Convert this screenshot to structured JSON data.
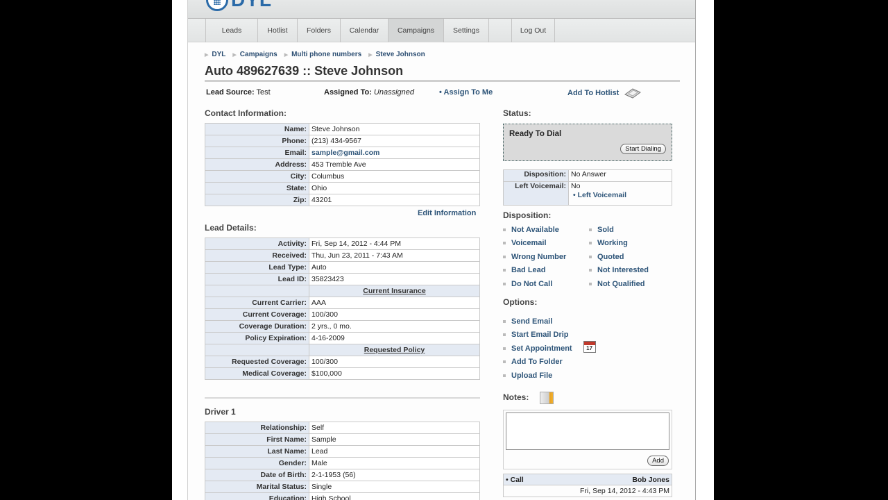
{
  "app": {
    "logo_text": "DYL"
  },
  "nav": {
    "items": [
      {
        "label": "Leads"
      },
      {
        "label": "Hotlist"
      },
      {
        "label": "Folders"
      },
      {
        "label": "Calendar"
      },
      {
        "label": "Campaigns",
        "active": true
      },
      {
        "label": "Settings"
      },
      {
        "label": ""
      },
      {
        "label": "Log Out"
      }
    ]
  },
  "breadcrumb": [
    "DYL",
    "Campaigns",
    "Multi phone numbers",
    "Steve Johnson"
  ],
  "page_title": "Auto 489627639 :: Steve Johnson",
  "meta": {
    "lead_source_label": "Lead Source:",
    "lead_source_value": "Test",
    "assigned_to_label": "Assigned To:",
    "assigned_to_value": "Unassigned",
    "assign_to_me": "• Assign To Me",
    "add_to_hotlist": "Add To Hotlist"
  },
  "contact": {
    "title": "Contact Information:",
    "rows": [
      {
        "k": "Name:",
        "v": "Steve Johnson"
      },
      {
        "k": "Phone:",
        "v": "(213) 434-9567"
      },
      {
        "k": "Email:",
        "v": "sample@gmail.com"
      },
      {
        "k": "Address:",
        "v": "453 Tremble Ave"
      },
      {
        "k": "City:",
        "v": "Columbus"
      },
      {
        "k": "State:",
        "v": "Ohio"
      },
      {
        "k": "Zip:",
        "v": "43201"
      }
    ],
    "edit_link": "Edit Information"
  },
  "lead_details": {
    "title": "Lead Details:",
    "rows": [
      {
        "k": "Activity:",
        "v": "Fri, Sep 14, 2012 - 4:44 PM"
      },
      {
        "k": "Received:",
        "v": "Thu, Jun 23, 2011 - 7:43 AM"
      },
      {
        "k": "Lead Type:",
        "v": "Auto"
      },
      {
        "k": "Lead ID:",
        "v": "35823423"
      },
      {
        "sub": "Current Insurance"
      },
      {
        "k": "Current Carrier:",
        "v": "AAA"
      },
      {
        "k": "Current Coverage:",
        "v": "100/300"
      },
      {
        "k": "Coverage Duration:",
        "v": "2 yrs., 0 mo."
      },
      {
        "k": "Policy Expiration:",
        "v": "4-16-2009"
      },
      {
        "sub": "Requested Policy"
      },
      {
        "k": "Requested Coverage:",
        "v": "100/300"
      },
      {
        "k": "Medical Coverage:",
        "v": "$100,000"
      }
    ]
  },
  "driver": {
    "title": "Driver 1",
    "rows": [
      {
        "k": "Relationship:",
        "v": "Self"
      },
      {
        "k": "First Name:",
        "v": "Sample"
      },
      {
        "k": "Last Name:",
        "v": "Lead"
      },
      {
        "k": "Gender:",
        "v": "Male"
      },
      {
        "k": "Date of Birth:",
        "v": "2-1-1953 (56)"
      },
      {
        "k": "Marital Status:",
        "v": "Single"
      },
      {
        "k": "Education:",
        "v": "High School"
      }
    ]
  },
  "status": {
    "title": "Status:",
    "text": "Ready To Dial",
    "button": "Start Dialing",
    "disposition_label": "Disposition:",
    "disposition_value": "No Answer",
    "voicemail_label": "Left Voicemail:",
    "voicemail_value": "No",
    "voicemail_link": "• Left Voicemail"
  },
  "disposition": {
    "title": "Disposition:",
    "left": [
      "Not Available",
      "Voicemail",
      "Wrong Number",
      "Bad Lead",
      "Do Not Call"
    ],
    "right": [
      "Sold",
      "Working",
      "Quoted",
      "Not Interested",
      "Not Qualified"
    ]
  },
  "options": {
    "title": "Options:",
    "items": [
      "Send Email",
      "Start Email Drip",
      "Set Appointment",
      "Add To Folder",
      "Upload File"
    ],
    "calendar_day": "17"
  },
  "notes": {
    "title": "Notes:",
    "value": "",
    "add_button": "Add",
    "entries": [
      {
        "type": "• Call",
        "author": "Bob Jones",
        "date": "Fri, Sep 14, 2012 - 4:43 PM"
      }
    ]
  }
}
